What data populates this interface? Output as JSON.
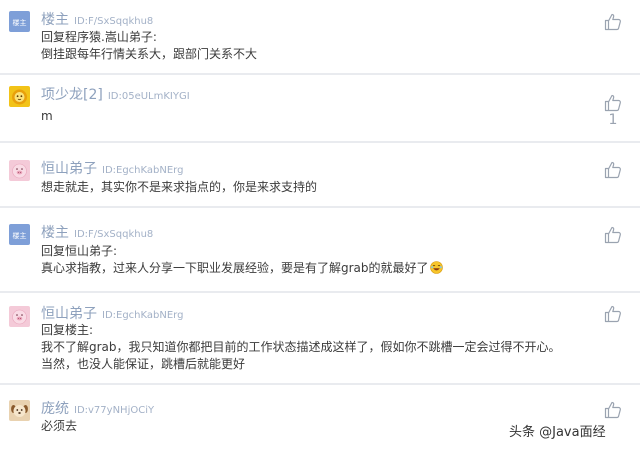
{
  "comments": [
    {
      "username": "楼主",
      "id": "ID:F/SxSqqkhu8",
      "avatar_label": "楼主",
      "avatar_color": "#7e9fd8",
      "lines": [
        "回复程序猿.嵩山弟子:",
        "倒挂跟每年行情关系大，跟部门关系不大"
      ],
      "like_count": ""
    },
    {
      "username": "项少龙[2]",
      "id": "ID:05eULmKIYGI",
      "avatar_icon": "lion-icon",
      "avatar_color": "#f2c318",
      "lines": [
        "m"
      ],
      "like_count": "1"
    },
    {
      "username": "恒山弟子",
      "id": "ID:EgchKabNErg",
      "avatar_icon": "pig-icon",
      "avatar_color": "#f4cad8",
      "lines": [
        "想走就走，其实你不是来求指点的，你是来求支持的"
      ],
      "like_count": ""
    },
    {
      "username": "楼主",
      "id": "ID:F/SxSqqkhu8",
      "avatar_label": "楼主",
      "avatar_color": "#7e9fd8",
      "lines": [
        "回复恒山弟子:",
        "真心求指教，过来人分享一下职业发展经验，要是有了解grab的就最好了"
      ],
      "emoji": "laughing-emoji",
      "like_count": ""
    },
    {
      "username": "恒山弟子",
      "id": "ID:EgchKabNErg",
      "avatar_icon": "pig-icon",
      "avatar_color": "#f4cad8",
      "lines": [
        "回复楼主:",
        "我不了解grab，我只知道你都把目前的工作状态描述成这样了，假如你不跳槽一定会过得不开心。",
        "当然，也没人能保证，跳槽后就能更好"
      ],
      "like_count": ""
    },
    {
      "username": "庞统",
      "id": "ID:v77yNHjOCiY",
      "avatar_icon": "dog-icon",
      "avatar_color": "#e9d2b0",
      "lines": [
        "必须去"
      ],
      "like_count": ""
    }
  ],
  "watermark": "头条 @Java面经",
  "like_icon": "thumbs-up-icon"
}
